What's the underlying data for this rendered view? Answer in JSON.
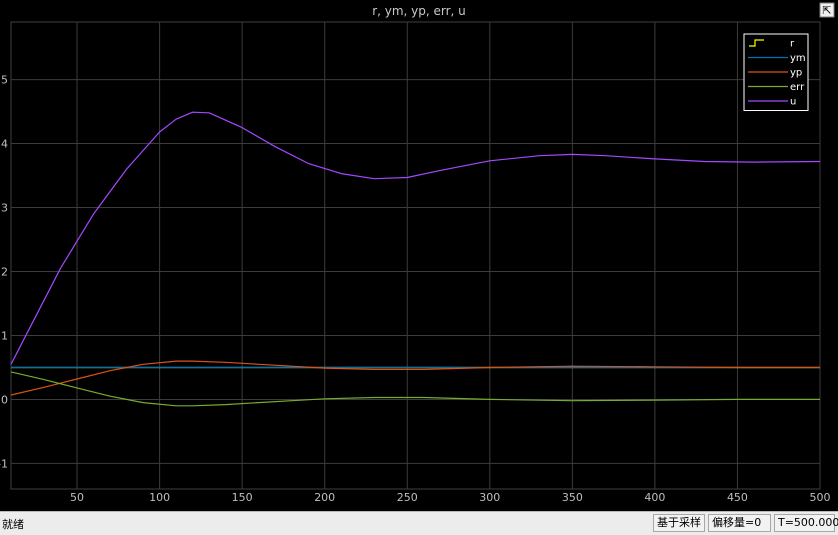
{
  "window": {
    "title": "r, ym, yp, err, u"
  },
  "status": {
    "ready": "就绪",
    "mode": "基于采样",
    "offset": "偏移量=0",
    "time": "T=500.000"
  },
  "chart_data": {
    "type": "line",
    "title": "r, ym, yp, err, u",
    "xlabel": "",
    "ylabel": "",
    "xlim": [
      10,
      500
    ],
    "ylim": [
      -1.4,
      5.9
    ],
    "xticks": [
      50,
      100,
      150,
      200,
      250,
      300,
      350,
      400,
      450,
      500
    ],
    "yticks": [
      -1,
      0,
      1,
      2,
      3,
      4,
      5
    ],
    "grid": true,
    "legend_position": "top-right",
    "background": "#000000",
    "series": [
      {
        "name": "r",
        "color": "#ffff00",
        "legend_marker": "step",
        "x": [
          10,
          500
        ],
        "y": [
          0.5,
          0.5
        ]
      },
      {
        "name": "ym",
        "color": "#0072bd",
        "x": [
          10,
          500
        ],
        "y": [
          0.5,
          0.5
        ]
      },
      {
        "name": "yp",
        "color": "#d95319",
        "x": [
          10,
          30,
          50,
          70,
          90,
          110,
          120,
          140,
          160,
          180,
          200,
          230,
          260,
          300,
          350,
          400,
          450,
          500
        ],
        "y": [
          0.07,
          0.19,
          0.32,
          0.45,
          0.55,
          0.6,
          0.6,
          0.58,
          0.55,
          0.52,
          0.49,
          0.47,
          0.47,
          0.5,
          0.52,
          0.51,
          0.5,
          0.5
        ]
      },
      {
        "name": "err",
        "color": "#77ac30",
        "x": [
          10,
          30,
          50,
          70,
          90,
          110,
          120,
          140,
          160,
          180,
          200,
          230,
          260,
          300,
          350,
          400,
          450,
          500
        ],
        "y": [
          0.43,
          0.31,
          0.18,
          0.05,
          -0.05,
          -0.1,
          -0.1,
          -0.08,
          -0.05,
          -0.02,
          0.01,
          0.03,
          0.03,
          0.0,
          -0.02,
          -0.01,
          0.0,
          0.0
        ]
      },
      {
        "name": "u",
        "color": "#a349ff",
        "x": [
          10,
          20,
          40,
          60,
          80,
          100,
          110,
          120,
          130,
          150,
          170,
          190,
          210,
          230,
          250,
          270,
          300,
          330,
          350,
          370,
          400,
          430,
          460,
          500
        ],
        "y": [
          0.55,
          1.05,
          2.05,
          2.9,
          3.6,
          4.18,
          4.38,
          4.49,
          4.48,
          4.25,
          3.95,
          3.69,
          3.53,
          3.45,
          3.47,
          3.58,
          3.73,
          3.81,
          3.83,
          3.81,
          3.76,
          3.72,
          3.71,
          3.72
        ]
      }
    ]
  }
}
